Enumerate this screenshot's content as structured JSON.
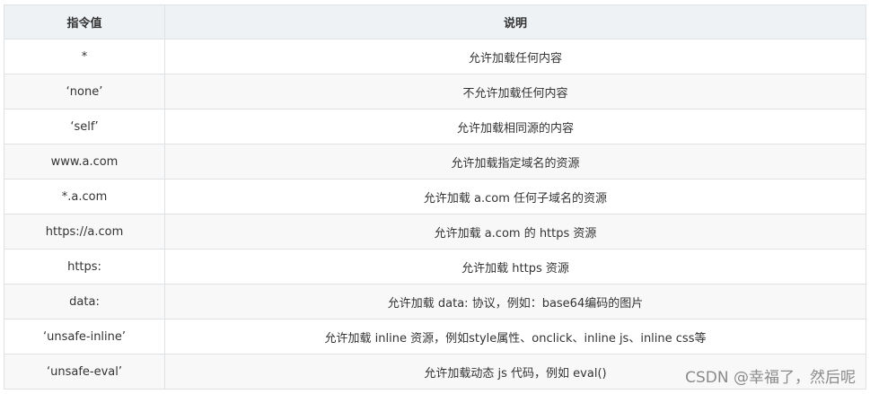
{
  "table": {
    "headers": [
      "指令值",
      "说明"
    ],
    "rows": [
      {
        "value": "*",
        "desc": "允许加载任何内容"
      },
      {
        "value": "‘none’",
        "desc": "不允许加载任何内容"
      },
      {
        "value": "‘self’",
        "desc": "允许加载相同源的内容"
      },
      {
        "value": "www.a.com",
        "desc": "允许加载指定域名的资源"
      },
      {
        "value": "*.a.com",
        "desc": "允许加载 a.com 任何子域名的资源"
      },
      {
        "value": "https://a.com",
        "desc": "允许加载 a.com 的 https 资源"
      },
      {
        "value": "https:",
        "desc": "允许加载 https 资源"
      },
      {
        "value": "data:",
        "desc": "允许加载 data: 协议，例如：base64编码的图片"
      },
      {
        "value": "‘unsafe-inline’",
        "desc": "允许加载 inline 资源，例如style属性、onclick、inline js、inline css等"
      },
      {
        "value": "‘unsafe-eval’",
        "desc": "允许加载动态 js 代码，例如 eval()"
      }
    ]
  },
  "watermark": "CSDN @幸福了，然后呢"
}
